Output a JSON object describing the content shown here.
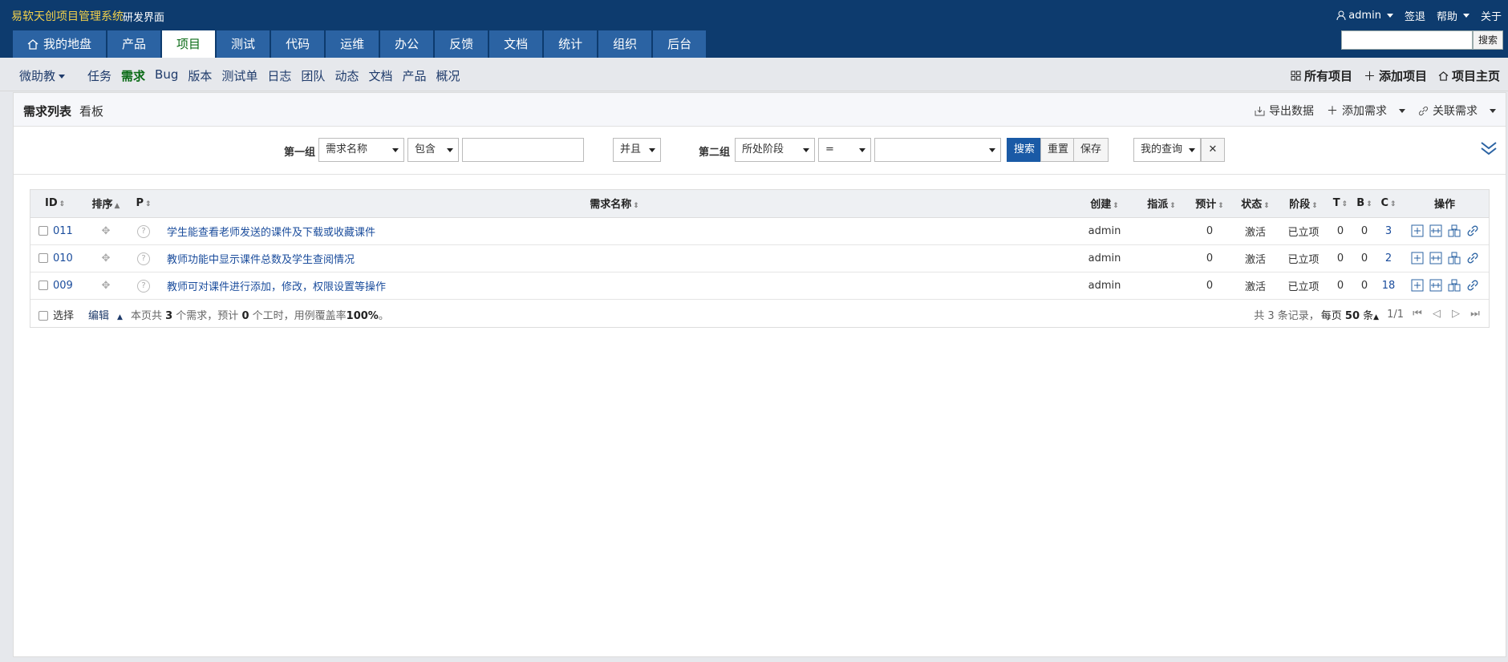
{
  "header": {
    "brand": "易软天创项目管理系统",
    "sub": "研发界面",
    "user": "admin",
    "sign_out": "签退",
    "help": "帮助",
    "about": "关于"
  },
  "tabs": [
    "我的地盘",
    "产品",
    "项目",
    "测试",
    "代码",
    "运维",
    "办公",
    "反馈",
    "文档",
    "统计",
    "组织",
    "后台"
  ],
  "search": {
    "button": "搜索"
  },
  "subnav": {
    "project": "微助教",
    "items": [
      "任务",
      "需求",
      "Bug",
      "版本",
      "测试单",
      "日志",
      "团队",
      "动态",
      "文档",
      "产品",
      "概况"
    ],
    "right": [
      "所有项目",
      "添加项目",
      "项目主页"
    ]
  },
  "panel": {
    "views": [
      "需求列表",
      "看板"
    ],
    "actions": [
      "导出数据",
      "添加需求",
      "关联需求"
    ]
  },
  "filter": {
    "group1": "第一组",
    "field1": "需求名称",
    "op1": "包含",
    "val1": "",
    "and": "并且",
    "group2": "第二组",
    "field2": "所处阶段",
    "op2": "=",
    "val2": "",
    "search": "搜索",
    "reset": "重置",
    "save": "保存",
    "query": "我的查询"
  },
  "table": {
    "headers": [
      "ID",
      "排序",
      "P",
      "需求名称",
      "创建",
      "指派",
      "预计",
      "状态",
      "阶段",
      "T",
      "B",
      "C",
      "操作"
    ],
    "rows": [
      {
        "id": "011",
        "name": "学生能查看老师发送的课件及下载或收藏课件",
        "creator": "admin",
        "assign": "",
        "est": "0",
        "status": "激活",
        "stage": "已立项",
        "t": "0",
        "b": "0",
        "c": "3"
      },
      {
        "id": "010",
        "name": "教师功能中显示课件总数及学生查阅情况",
        "creator": "admin",
        "assign": "",
        "est": "0",
        "status": "激活",
        "stage": "已立项",
        "t": "0",
        "b": "0",
        "c": "2"
      },
      {
        "id": "009",
        "name": "教师可对课件进行添加，修改，权限设置等操作",
        "creator": "admin",
        "assign": "",
        "est": "0",
        "status": "激活",
        "stage": "已立项",
        "t": "0",
        "b": "0",
        "c": "18"
      }
    ]
  },
  "footer": {
    "select": "选择",
    "edit": "编辑",
    "summary_a": "本页共",
    "count": "3",
    "summary_b": "个需求，预计",
    "hours": "0",
    "summary_c": "个工时，用例覆盖率",
    "cover": "100%",
    "summary_d": "。",
    "records": "共 3 条记录，",
    "per_page": "每页",
    "per_page_num": "50",
    "per_page_unit": "条",
    "page": "1/1"
  }
}
